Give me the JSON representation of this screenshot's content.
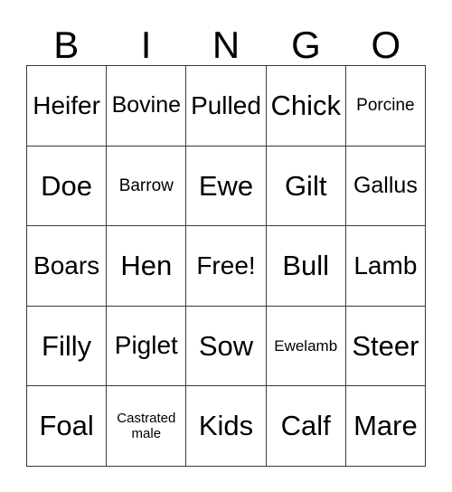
{
  "card": {
    "background_color": "#ffffff",
    "border_color": "#3a3a3a",
    "text_color": "#000000"
  },
  "header": {
    "letters": [
      {
        "label": "B"
      },
      {
        "label": "I"
      },
      {
        "label": "N"
      },
      {
        "label": "G"
      },
      {
        "label": "O"
      }
    ]
  },
  "grid": {
    "columns": 5,
    "rows": 5,
    "free_space": {
      "row": 2,
      "col": 2,
      "label": "Free!"
    },
    "cells": [
      [
        {
          "label": "Heifer",
          "size": "lg",
          "free": false
        },
        {
          "label": "Bovine",
          "size": "md",
          "free": false
        },
        {
          "label": "Pulled",
          "size": "lg",
          "free": false
        },
        {
          "label": "Chick",
          "size": "xl",
          "free": false
        },
        {
          "label": "Porcine",
          "size": "sm",
          "free": false
        }
      ],
      [
        {
          "label": "Doe",
          "size": "xl",
          "free": false
        },
        {
          "label": "Barrow",
          "size": "sm",
          "free": false
        },
        {
          "label": "Ewe",
          "size": "xl",
          "free": false
        },
        {
          "label": "Gilt",
          "size": "xl",
          "free": false
        },
        {
          "label": "Gallus",
          "size": "md",
          "free": false
        }
      ],
      [
        {
          "label": "Boars",
          "size": "lg",
          "free": false
        },
        {
          "label": "Hen",
          "size": "xl",
          "free": false
        },
        {
          "label": "Free!",
          "size": "lg",
          "free": true
        },
        {
          "label": "Bull",
          "size": "xl",
          "free": false
        },
        {
          "label": "Lamb",
          "size": "lg",
          "free": false
        }
      ],
      [
        {
          "label": "Filly",
          "size": "xl",
          "free": false
        },
        {
          "label": "Piglet",
          "size": "lg",
          "free": false
        },
        {
          "label": "Sow",
          "size": "xl",
          "free": false
        },
        {
          "label": "Ewelamb",
          "size": "xs",
          "free": false
        },
        {
          "label": "Steer",
          "size": "xl",
          "free": false
        }
      ],
      [
        {
          "label": "Foal",
          "size": "xl",
          "free": false
        },
        {
          "label": "Castrated male",
          "size": "xxs",
          "free": false
        },
        {
          "label": "Kids",
          "size": "xl",
          "free": false
        },
        {
          "label": "Calf",
          "size": "xl",
          "free": false
        },
        {
          "label": "Mare",
          "size": "xl",
          "free": false
        }
      ]
    ]
  }
}
